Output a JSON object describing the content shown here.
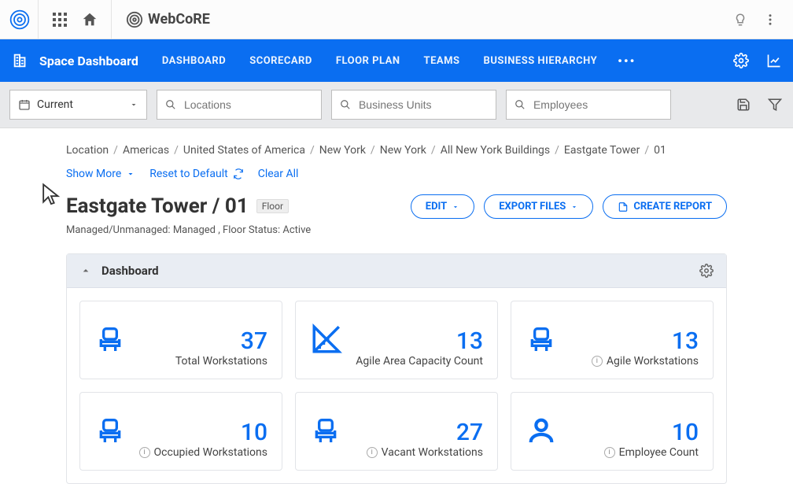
{
  "header": {
    "brand": "WebCoRE"
  },
  "nav": {
    "page_label": "Space Dashboard",
    "tabs": [
      "DASHBOARD",
      "SCORECARD",
      "FLOOR PLAN",
      "TEAMS",
      "BUSINESS HIERARCHY"
    ]
  },
  "filters": {
    "dropdown_value": "Current",
    "search1_placeholder": "Locations",
    "search2_placeholder": "Business Units",
    "search3_placeholder": "Employees"
  },
  "breadcrumb": [
    "Location",
    "Americas",
    "United States of America",
    "New York",
    "New York",
    "All New York Buildings",
    "Eastgate Tower",
    "01"
  ],
  "page_links": {
    "show_more": "Show More",
    "reset": "Reset to Default",
    "clear": "Clear All"
  },
  "title": {
    "main": "Eastgate Tower / 01",
    "chip": "Floor",
    "meta_label1": "Managed/Unmanaged:",
    "meta_val1": "Managed",
    "comma": " , ",
    "meta_label2": "Floor Status:",
    "meta_val2": "Active"
  },
  "buttons": {
    "edit": "EDIT",
    "export": "EXPORT FILES",
    "create": "CREATE REPORT"
  },
  "panel": {
    "title": "Dashboard"
  },
  "cards": [
    {
      "value": "37",
      "label": "Total Workstations",
      "icon": "chair",
      "info": false
    },
    {
      "value": "13",
      "label": "Agile Area Capacity Count",
      "icon": "ruler",
      "info": false
    },
    {
      "value": "13",
      "label": "Agile Workstations",
      "icon": "chair",
      "info": true
    },
    {
      "value": "10",
      "label": "Occupied Workstations",
      "icon": "chair",
      "info": true
    },
    {
      "value": "27",
      "label": "Vacant Workstations",
      "icon": "chair",
      "info": true
    },
    {
      "value": "10",
      "label": "Employee Count",
      "icon": "person",
      "info": true
    }
  ]
}
